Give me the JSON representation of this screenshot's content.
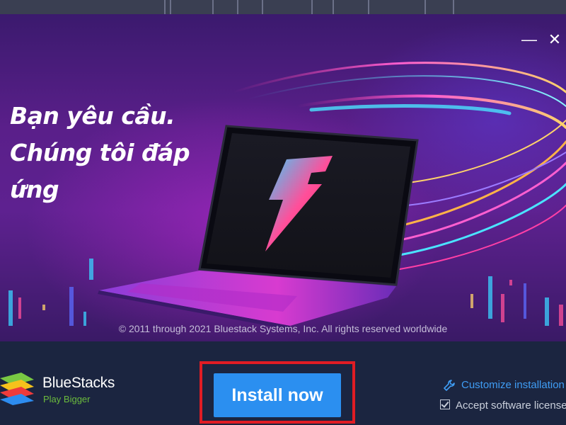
{
  "window": {
    "controls": {
      "minimize": "—",
      "close": "✕"
    }
  },
  "banner": {
    "headline": [
      "Bạn yêu cầu.",
      "Chúng tôi đáp",
      "ứng"
    ],
    "copyright": "© 2011 through 2021 Bluestack Systems, Inc. All rights reserved worldwide",
    "laptop_logo_icon": "bolt-5-logo-icon"
  },
  "footer": {
    "brand": "BlueStacks",
    "tagline": "Play Bigger",
    "install_label": "Install now",
    "customize_label": "Customize installation",
    "accept_label": "Accept software license",
    "accept_checked": true
  },
  "colors": {
    "install_button": "#2b8ff0",
    "highlight_box": "#e01c24",
    "footer_bg": "#1b2540",
    "link": "#3f9df5",
    "tagline": "#6bbb3d"
  }
}
